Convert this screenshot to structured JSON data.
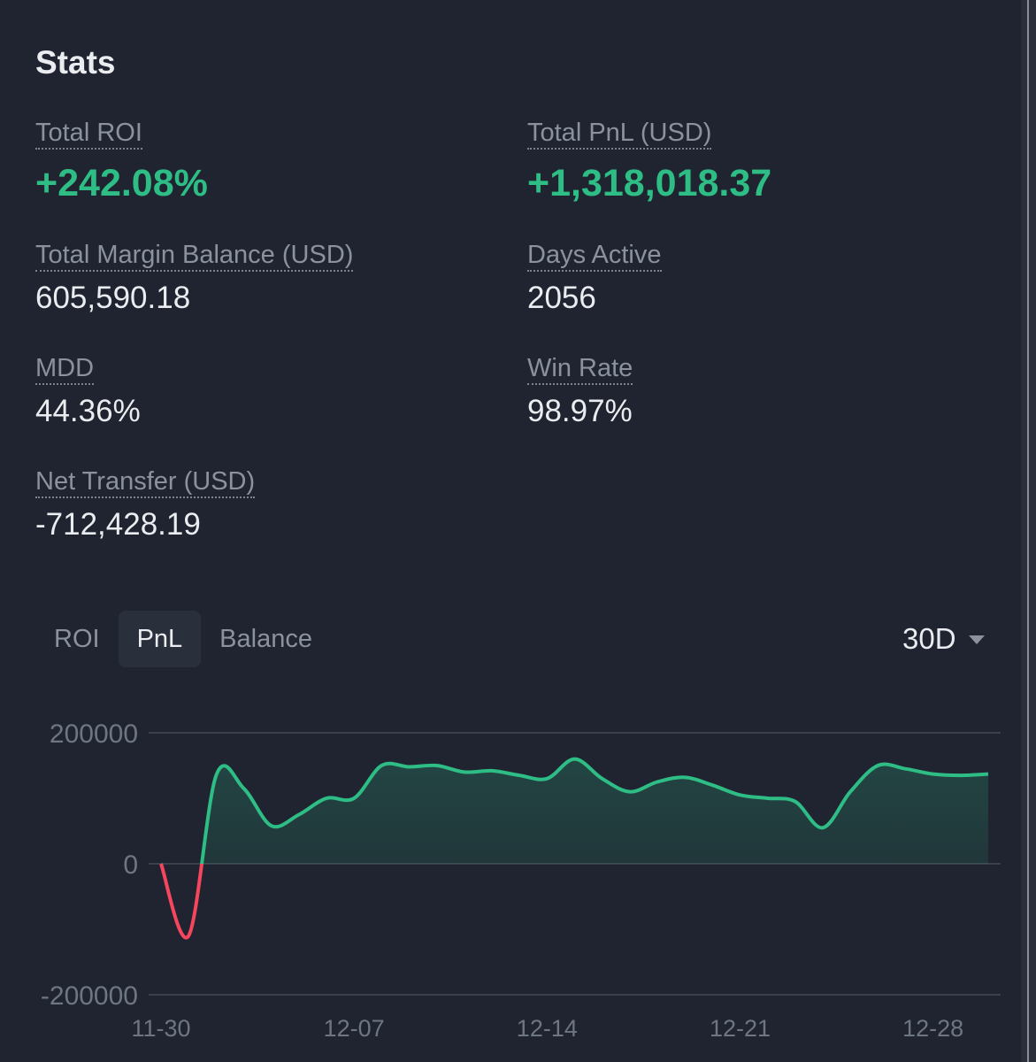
{
  "stats": {
    "title": "Stats",
    "total_roi_label": "Total ROI",
    "total_roi_value": "+242.08%",
    "total_pnl_label": "Total PnL (USD)",
    "total_pnl_value": "+1,318,018.37",
    "margin_label": "Total Margin Balance (USD)",
    "margin_value": "605,590.18",
    "days_label": "Days Active",
    "days_value": "2056",
    "mdd_label": "MDD",
    "mdd_value": "44.36%",
    "winrate_label": "Win Rate",
    "winrate_value": "98.97%",
    "transfer_label": "Net Transfer (USD)",
    "transfer_value": "-712,428.19"
  },
  "tabs": [
    {
      "label": "ROI",
      "active": false
    },
    {
      "label": "PnL",
      "active": true
    },
    {
      "label": "Balance",
      "active": false
    }
  ],
  "range": {
    "label": "30D"
  },
  "colors": {
    "positive": "#2ebd85",
    "negative": "#f6465d",
    "background": "#1f2430",
    "muted": "#8b929e"
  },
  "chart_data": {
    "type": "line",
    "x": [
      "11-30",
      "12-01",
      "12-02",
      "12-03",
      "12-04",
      "12-05",
      "12-06",
      "12-07",
      "12-08",
      "12-09",
      "12-10",
      "12-11",
      "12-12",
      "12-13",
      "12-14",
      "12-15",
      "12-16",
      "12-17",
      "12-18",
      "12-19",
      "12-20",
      "12-21",
      "12-22",
      "12-23",
      "12-24",
      "12-25",
      "12-26",
      "12-27",
      "12-28",
      "12-29",
      "12-30"
    ],
    "series": [
      {
        "values": [
          0,
          -110000,
          135000,
          115000,
          58000,
          75000,
          100000,
          100000,
          150000,
          148000,
          150000,
          140000,
          142000,
          135000,
          130000,
          160000,
          130000,
          110000,
          125000,
          132000,
          120000,
          105000,
          100000,
          95000,
          55000,
          110000,
          150000,
          145000,
          137000,
          135000,
          137000
        ]
      }
    ],
    "xticks": [
      "11-30",
      "12-07",
      "12-14",
      "12-21",
      "12-28"
    ],
    "yticks": [
      "200000",
      "0",
      "-200000"
    ],
    "ylim": [
      -200000,
      200000
    ],
    "grid": true,
    "fill_area": true
  }
}
